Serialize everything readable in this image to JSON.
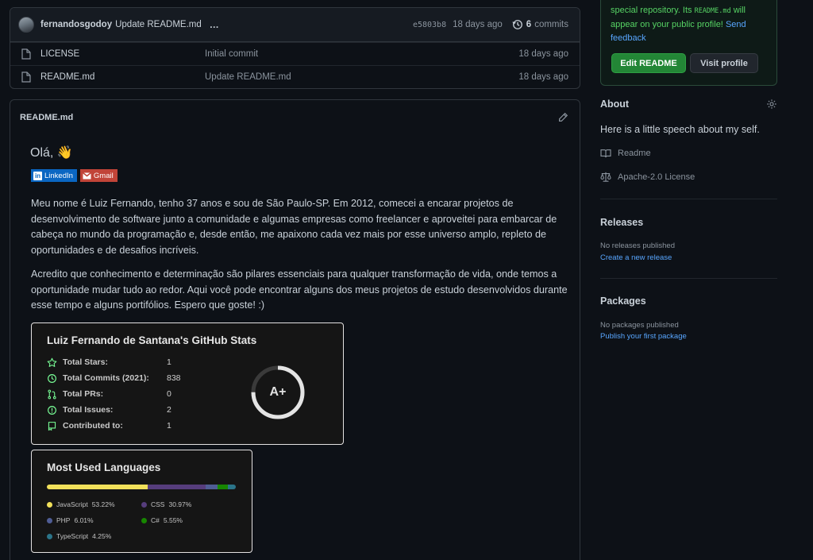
{
  "files": {
    "last_commit": {
      "author": "fernandosgodoy",
      "message": "Update README.md",
      "ellipsis": "…",
      "sha": "e5803b8",
      "age": "18 days ago",
      "commit_count": "6",
      "commit_label": "commits"
    },
    "rows": [
      {
        "name": "LICENSE",
        "commit": "Initial commit",
        "age": "18 days ago"
      },
      {
        "name": "README.md",
        "commit": "Update README.md",
        "age": "18 days ago"
      }
    ]
  },
  "readme": {
    "filename": "README.md",
    "greeting": "Olá, 👋",
    "badges": [
      {
        "label": "LinkedIn"
      },
      {
        "label": "Gmail"
      }
    ],
    "paragraph1": "Meu nome é Luiz Fernando, tenho 37 anos e sou de São Paulo-SP. Em 2012, comecei a encarar projetos de desenvolvimento de software junto a comunidade e algumas empresas como freelancer e aproveitei para embarcar de cabeça no mundo da programação e, desde então, me apaixono cada vez mais por esse universo amplo, repleto de oportunidades e de desafios incríveis.",
    "paragraph2": "Acredito que conhecimento e determinação são pilares essenciais para qualquer transformação de vida, onde temos a oportunidade mudar tudo ao redor. Aqui você pode encontrar alguns dos meus projetos de estudo desenvolvidos durante esse tempo e alguns portifólios. Espero que goste! :)"
  },
  "stats_card": {
    "title": "Luiz Fernando de Santana's GitHub Stats",
    "rows": [
      {
        "label": "Total Stars:",
        "value": "1",
        "icon": "star-icon"
      },
      {
        "label": "Total Commits (2021):",
        "value": "838",
        "icon": "history-icon"
      },
      {
        "label": "Total PRs:",
        "value": "0",
        "icon": "pull-request-icon"
      },
      {
        "label": "Total Issues:",
        "value": "2",
        "icon": "issue-icon"
      },
      {
        "label": "Contributed to:",
        "value": "1",
        "icon": "repo-icon"
      }
    ],
    "grade": "A+",
    "grade_progress": 0.75
  },
  "languages_card": {
    "title": "Most Used Languages",
    "languages": [
      {
        "name": "JavaScript",
        "percent": "53.22%",
        "share": 53.22,
        "color": "#f1e05a"
      },
      {
        "name": "CSS",
        "percent": "30.97%",
        "share": 30.97,
        "color": "#563d7c"
      },
      {
        "name": "PHP",
        "percent": "6.01%",
        "share": 6.01,
        "color": "#4f5d95"
      },
      {
        "name": "C#",
        "percent": "5.55%",
        "share": 5.55,
        "color": "#178600"
      },
      {
        "name": "TypeScript",
        "percent": "4.25%",
        "share": 4.25,
        "color": "#2b7489"
      }
    ]
  },
  "sidebar": {
    "promo": {
      "line1": "special repository. Its",
      "code": "README.md",
      "line2": "will appear on your public profile!",
      "feedback": "Send feedback",
      "edit_button": "Edit README",
      "visit_button": "Visit profile"
    },
    "about": {
      "heading": "About",
      "description": "Here is a little speech about my self.",
      "readme_label": "Readme",
      "license_label": "Apache-2.0 License"
    },
    "releases": {
      "heading": "Releases",
      "empty": "No releases published",
      "create_link": "Create a new release"
    },
    "packages": {
      "heading": "Packages",
      "empty": "No packages published",
      "publish_link": "Publish your first package"
    }
  },
  "colors": {
    "accent_green": "#238636",
    "link_blue": "#58a6ff",
    "bg": "#0d1117"
  }
}
